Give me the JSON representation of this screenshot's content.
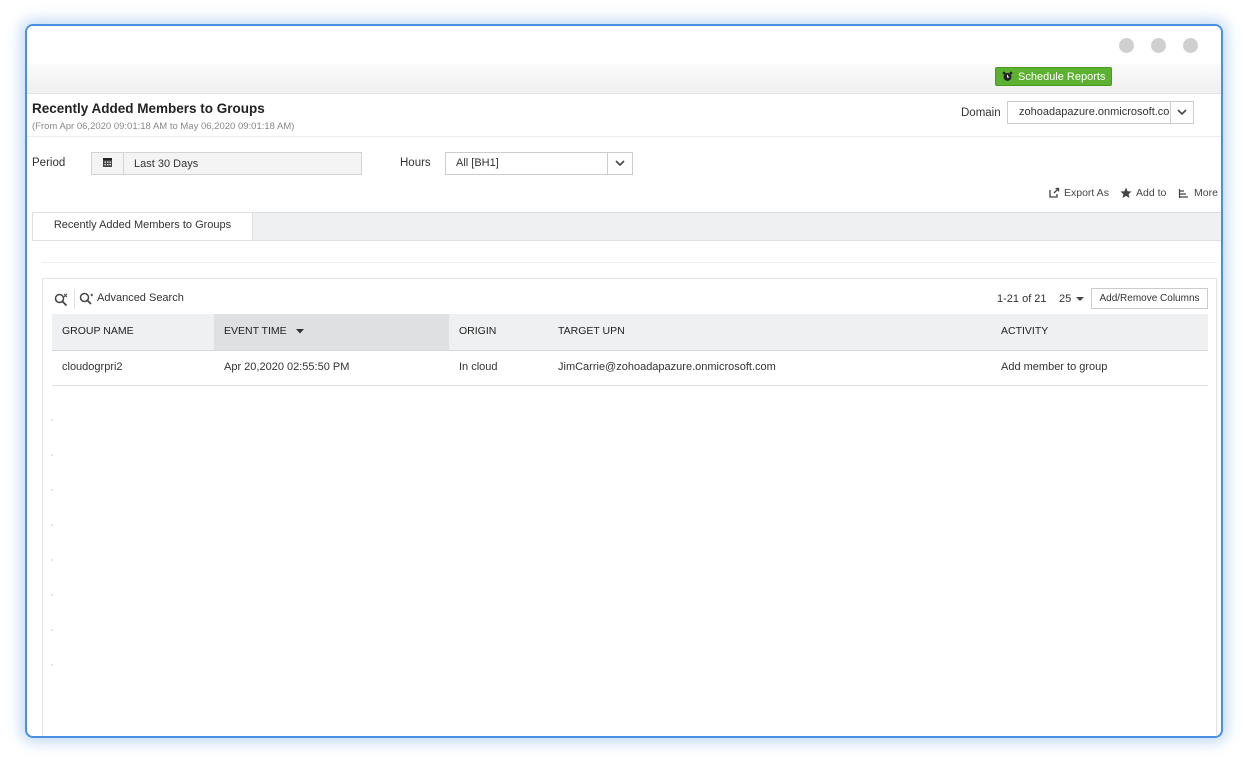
{
  "toolbar": {
    "schedule_label": "Schedule Reports"
  },
  "report": {
    "title": "Recently Added Members to Groups",
    "subtitle": "(From Apr 06,2020 09:01:18 AM to May 06,2020 09:01:18 AM)"
  },
  "domain": {
    "label": "Domain",
    "value": "zohoadapazure.onmicrosoft.com"
  },
  "filters": {
    "period_label": "Period",
    "period_value": "Last 30 Days",
    "hours_label": "Hours",
    "hours_value": "All [BH1]"
  },
  "actions": {
    "export": "Export As",
    "add_to": "Add to",
    "more": "More"
  },
  "tabs": [
    {
      "label": "Recently Added Members to Groups"
    }
  ],
  "grid": {
    "advanced_search": "Advanced Search",
    "pager": "1-21 of 21",
    "per_page": "25",
    "add_remove_columns": "Add/Remove Columns",
    "columns": [
      "GROUP NAME",
      "EVENT TIME",
      "ORIGIN",
      "TARGET UPN",
      "ACTIVITY"
    ],
    "sorted_column": "EVENT TIME",
    "rows": [
      {
        "group_name": "cloudogrpri2",
        "event_time": "Apr 20,2020 02:55:50 PM",
        "origin": "In cloud",
        "target_upn": "JimCarrie@zohoadapazure.onmicrosoft.com",
        "activity": "Add member to group"
      }
    ]
  },
  "colors": {
    "accent": "#4a90e2",
    "schedule_green": "#5cb230"
  }
}
